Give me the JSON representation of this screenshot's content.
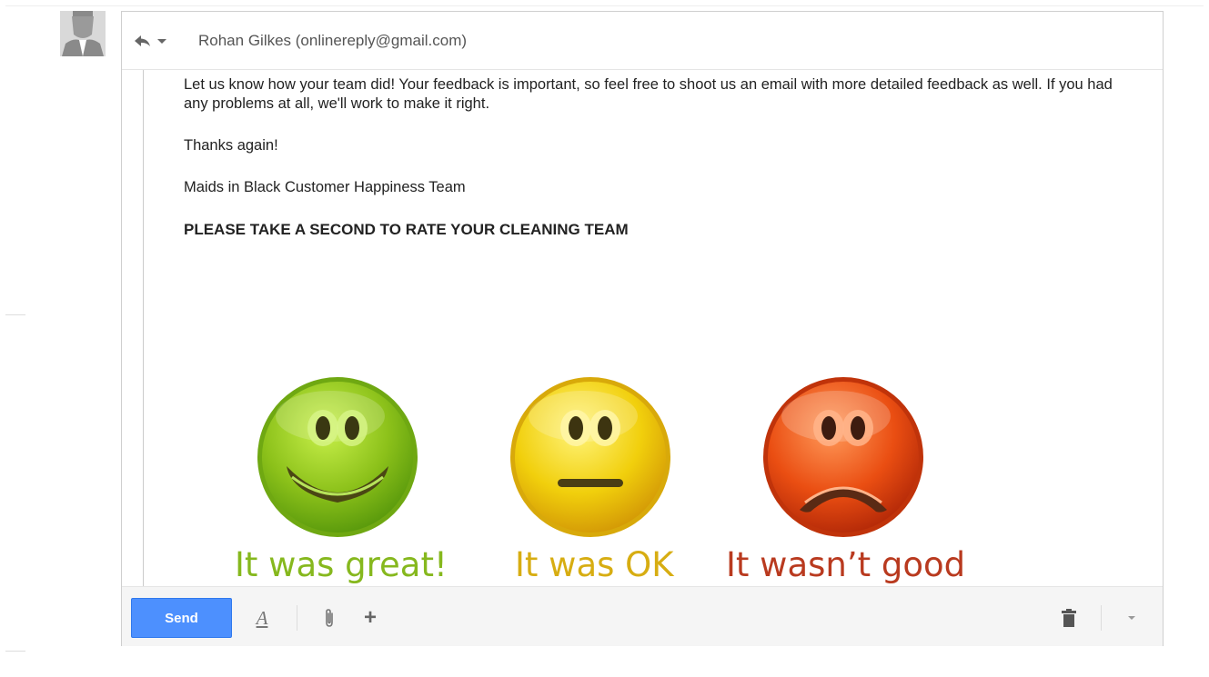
{
  "header": {
    "recipient": "Rohan Gilkes (onlinereply@gmail.com)"
  },
  "message": {
    "paragraph1": "Let us know how your team did! Your feedback is important, so feel free to shoot us an email with more detailed feedback as well. If you had any problems at all, we'll work to make it right.",
    "paragraph2": "Thanks again!",
    "signature": "Maids in Black Customer Happiness Team",
    "cta": "PLEASE TAKE A SECOND TO RATE YOUR CLEANING TEAM"
  },
  "ratings": [
    {
      "label": "It was great!",
      "icon": "happy-face-icon",
      "color": "#8cc11a",
      "label_color": "#86b81e"
    },
    {
      "label": "It was OK",
      "icon": "neutral-face-icon",
      "color": "#f1cf0c",
      "label_color": "#d7ad12"
    },
    {
      "label": "It wasn’t good",
      "icon": "sad-face-icon",
      "color": "#ea4e12",
      "label_color": "#b93a1f"
    }
  ],
  "toolbar": {
    "send_label": "Send",
    "formatting_icon": "text-format-icon",
    "attach_icon": "paperclip-icon",
    "more_icon": "plus-icon",
    "discard_icon": "trash-icon",
    "options_icon": "chevron-down-icon"
  },
  "colors": {
    "send_button": "#4d90fe",
    "toolbar_bg": "#f5f5f5"
  }
}
